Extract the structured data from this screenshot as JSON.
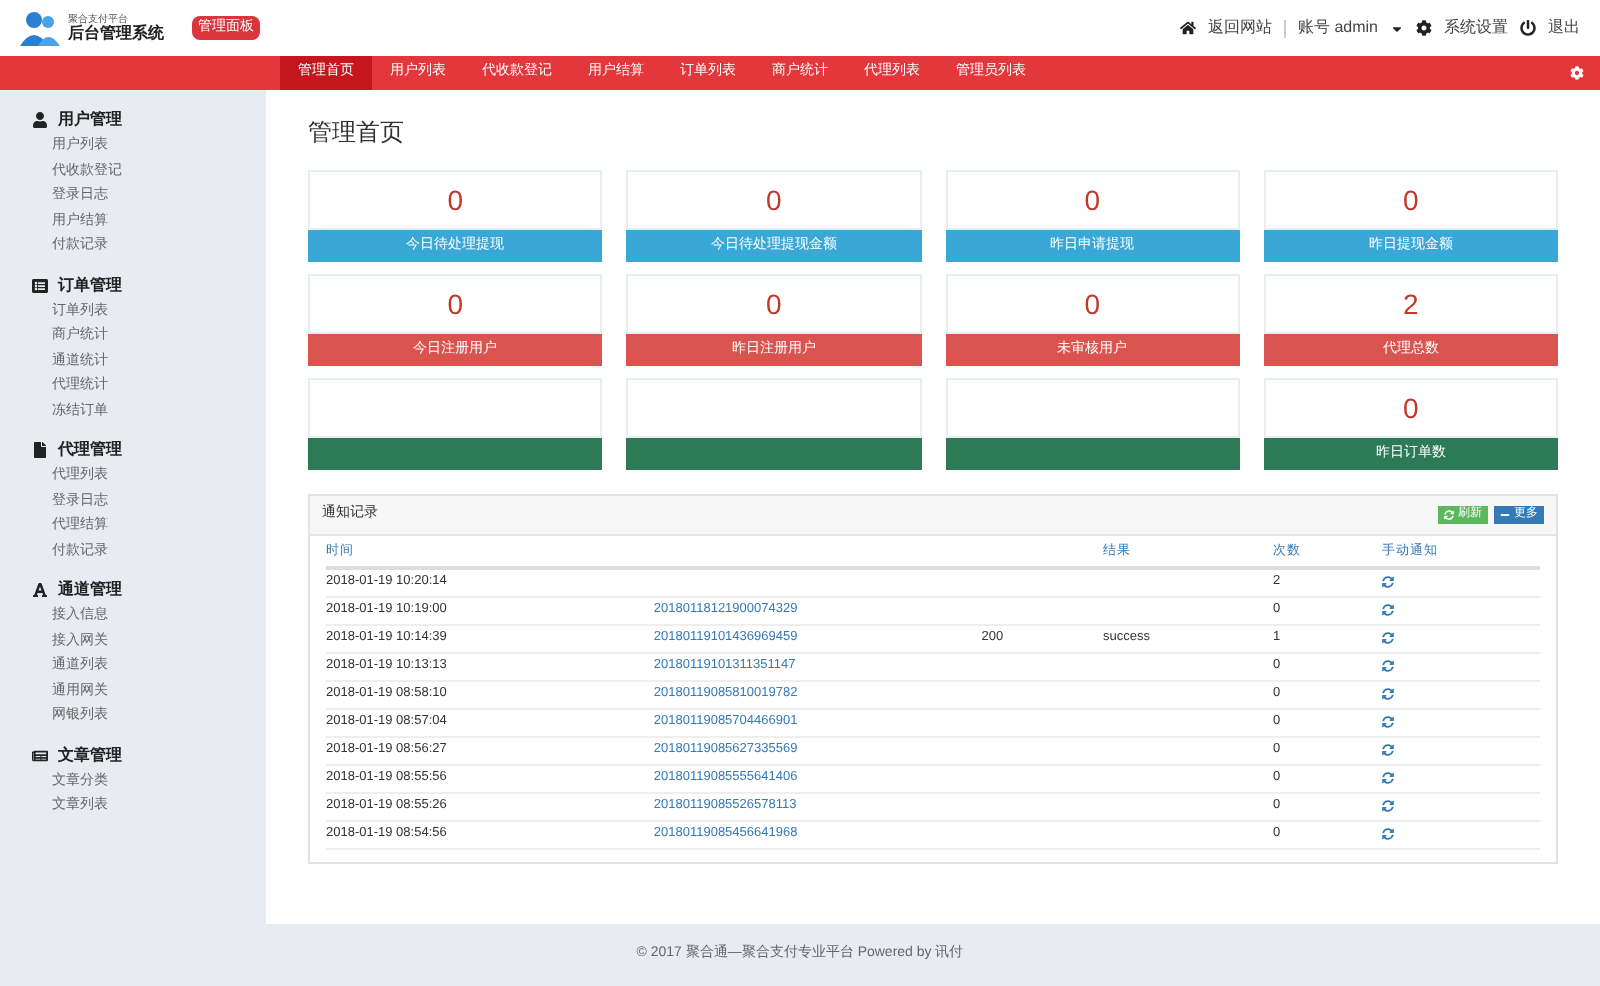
{
  "header": {
    "tagline": "聚合支付平台",
    "title": "后台管理系统",
    "badge": "管理面板",
    "links": [
      {
        "kind": "home",
        "label": "返回网站"
      },
      {
        "kind": "account",
        "label": "账号 admin"
      },
      {
        "kind": "settings",
        "label": "系统设置"
      },
      {
        "kind": "logout",
        "label": "退出"
      }
    ]
  },
  "nav": [
    {
      "label": "管理首页",
      "selected": true
    },
    {
      "label": "用户列表",
      "selected": false
    },
    {
      "label": "代收款登记",
      "selected": false
    },
    {
      "label": "用户结算",
      "selected": false
    },
    {
      "label": "订单列表",
      "selected": false
    },
    {
      "label": "商户统计",
      "selected": false
    },
    {
      "label": "代理列表",
      "selected": false
    },
    {
      "label": "管理员列表",
      "selected": false
    }
  ],
  "sidebar": [
    {
      "kind": "user",
      "title": "用户管理",
      "items": [
        "用户列表",
        "代收款登记",
        "登录日志",
        "用户结算",
        "付款记录"
      ]
    },
    {
      "kind": "list",
      "title": "订单管理",
      "items": [
        "订单列表",
        "商户统计",
        "通道统计",
        "代理统计",
        "冻结订单"
      ]
    },
    {
      "kind": "file",
      "title": "代理管理",
      "items": [
        "代理列表",
        "登录日志",
        "代理结算",
        "付款记录"
      ]
    },
    {
      "kind": "font",
      "title": "通道管理",
      "items": [
        "接入信息",
        "接入网关",
        "通道列表",
        "通用网关",
        "网银列表"
      ]
    },
    {
      "kind": "card",
      "title": "文章管理",
      "items": [
        "文章分类",
        "文章列表"
      ]
    }
  ],
  "page_title": "管理首页",
  "cards": [
    {
      "kind": "info",
      "value": "0",
      "label": "今日待处理提现"
    },
    {
      "kind": "info",
      "value": "0",
      "label": "今日待处理提现金额"
    },
    {
      "kind": "info",
      "value": "0",
      "label": "昨日申请提现"
    },
    {
      "kind": "info",
      "value": "0",
      "label": "昨日提现金额"
    },
    {
      "kind": "danger",
      "value": "0",
      "label": "今日注册用户"
    },
    {
      "kind": "danger",
      "value": "0",
      "label": "昨日注册用户"
    },
    {
      "kind": "danger",
      "value": "0",
      "label": "未审核用户"
    },
    {
      "kind": "danger",
      "value": "2",
      "label": "代理总数"
    },
    {
      "kind": "success"
    },
    {
      "kind": "success"
    },
    {
      "kind": "success"
    },
    {
      "kind": "success",
      "value": "0",
      "label": "昨日订单数"
    }
  ],
  "panel": {
    "title": "通知记录",
    "buttons": [
      {
        "kind": "refresh",
        "label": "刷新"
      },
      {
        "kind": "more",
        "label": "更多"
      }
    ],
    "columns": [
      {
        "label": "时间"
      },
      {},
      {},
      {
        "label": "结果"
      },
      {
        "label": "次数"
      },
      {
        "label": "手动通知"
      }
    ],
    "rows": [
      {
        "time": "2018-01-19 10:20:14",
        "count": "2"
      },
      {
        "time": "2018-01-19 10:19:00",
        "order": "20180118121900074329",
        "count": "0"
      },
      {
        "time": "2018-01-19 10:14:39",
        "order": "20180119101436969459",
        "code": "200",
        "result": "success",
        "count": "1"
      },
      {
        "time": "2018-01-19 10:13:13",
        "order": "20180119101311351147",
        "count": "0"
      },
      {
        "time": "2018-01-19 08:58:10",
        "order": "20180119085810019782",
        "count": "0"
      },
      {
        "time": "2018-01-19 08:57:04",
        "order": "20180119085704466901",
        "count": "0"
      },
      {
        "time": "2018-01-19 08:56:27",
        "order": "20180119085627335569",
        "count": "0"
      },
      {
        "time": "2018-01-19 08:55:56",
        "order": "20180119085555641406",
        "count": "0"
      },
      {
        "time": "2018-01-19 08:55:26",
        "order": "20180119085526578113",
        "count": "0"
      },
      {
        "time": "2018-01-19 08:54:56",
        "order": "20180119085456641968",
        "count": "0"
      }
    ]
  },
  "footer": "© 2017 聚合通—聚合支付专业平台 Powered by 讯付"
}
